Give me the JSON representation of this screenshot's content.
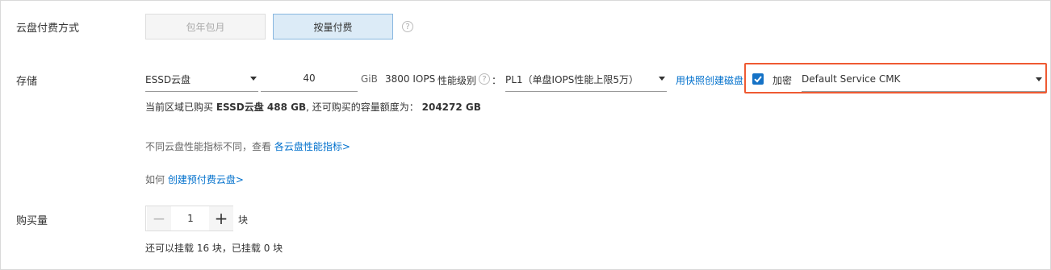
{
  "payment": {
    "label": "云盘付费方式",
    "options": [
      "包年包月",
      "按量付费"
    ],
    "selected": "按量付费"
  },
  "storage": {
    "label": "存储",
    "disk_type": "ESSD云盘",
    "size_value": "40",
    "size_unit": "GiB",
    "iops": "3800 IOPS",
    "perf_level_label": "性能级别",
    "perf_level_colon": "：",
    "perf_level_value": "PL1（单盘IOPS性能上限5万）",
    "snapshot_link": "用快照创建磁盘",
    "encrypt_checked": true,
    "encrypt_label": "加密",
    "cmk_value": "Default Service CMK",
    "quota_prefix": "当前区域已购买",
    "quota_bought": "ESSD云盘 488 GB",
    "quota_middle": ", 还可购买的容量额度为：",
    "quota_remaining": "204272 GB",
    "perf_note_text": "不同云盘性能指标不同，查看",
    "perf_note_link": "各云盘性能指标>",
    "prepaid_text": "如何",
    "prepaid_link": "创建预付费云盘>"
  },
  "quantity": {
    "label": "购买量",
    "minus": "−",
    "value": "1",
    "plus": "+",
    "unit": "块",
    "mount_note": "还可以挂载 16 块，已挂载 0 块"
  },
  "icons": {
    "help": "question-circle-icon",
    "check": "checkmark-icon",
    "caret": "caret-down-icon"
  },
  "colors": {
    "selected_bg": "#dcebf7",
    "selected_border": "#88b7e0",
    "link": "#0070cc",
    "checkbox": "#1572c6",
    "highlight": "#ef5a32"
  }
}
